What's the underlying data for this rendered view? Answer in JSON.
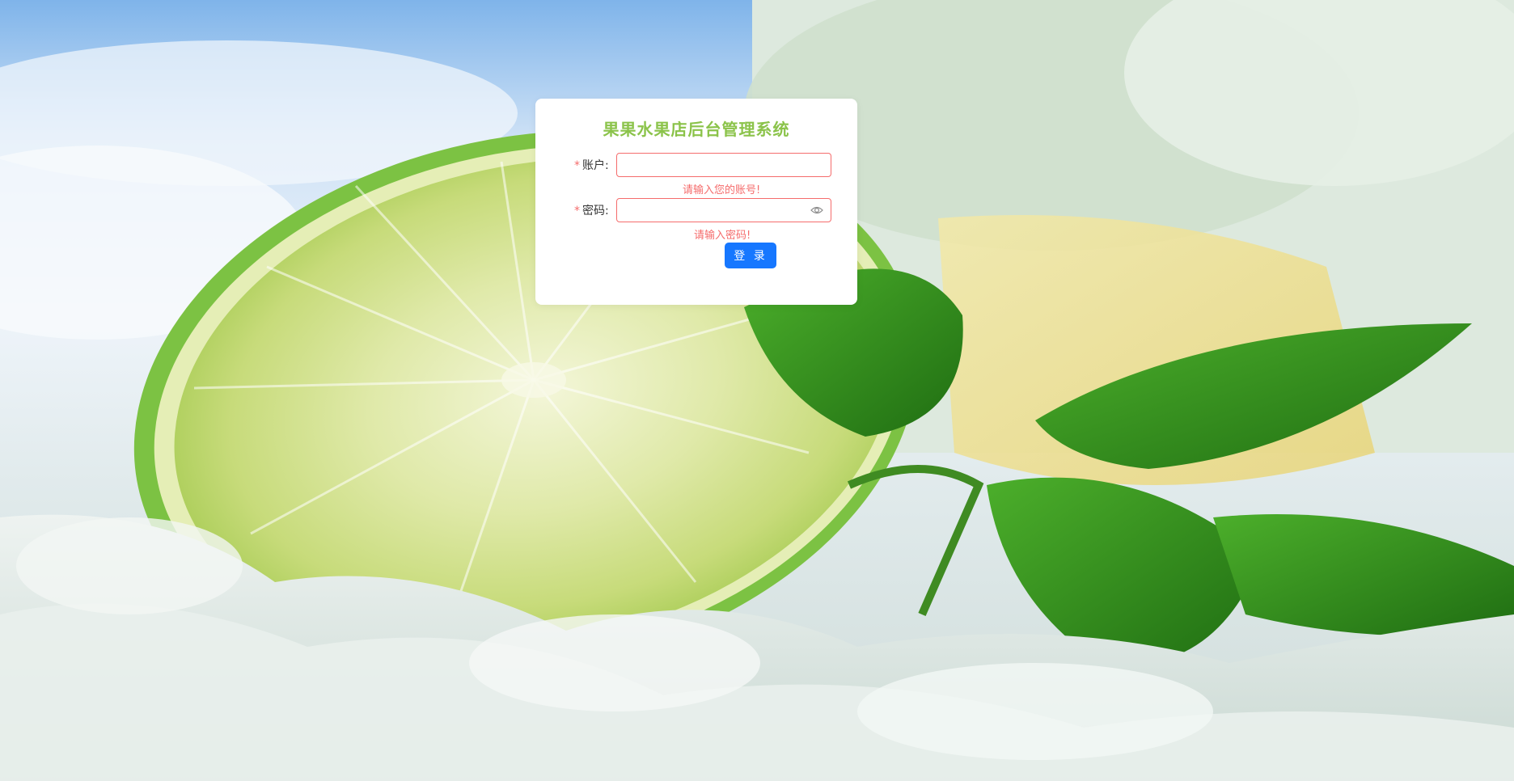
{
  "login": {
    "title": "果果水果店后台管理系统",
    "account": {
      "required_mark": "*",
      "label": "账户:",
      "value": "",
      "error": "请输入您的账号!"
    },
    "password": {
      "required_mark": "*",
      "label": "密码:",
      "value": "",
      "error": "请输入密码!",
      "toggle_icon": "eye-icon"
    },
    "submit_label": "登 录"
  },
  "colors": {
    "title": "#8bc34a",
    "error": "#f56c6c",
    "primary_button": "#1677ff",
    "card_background": "#ffffff"
  }
}
